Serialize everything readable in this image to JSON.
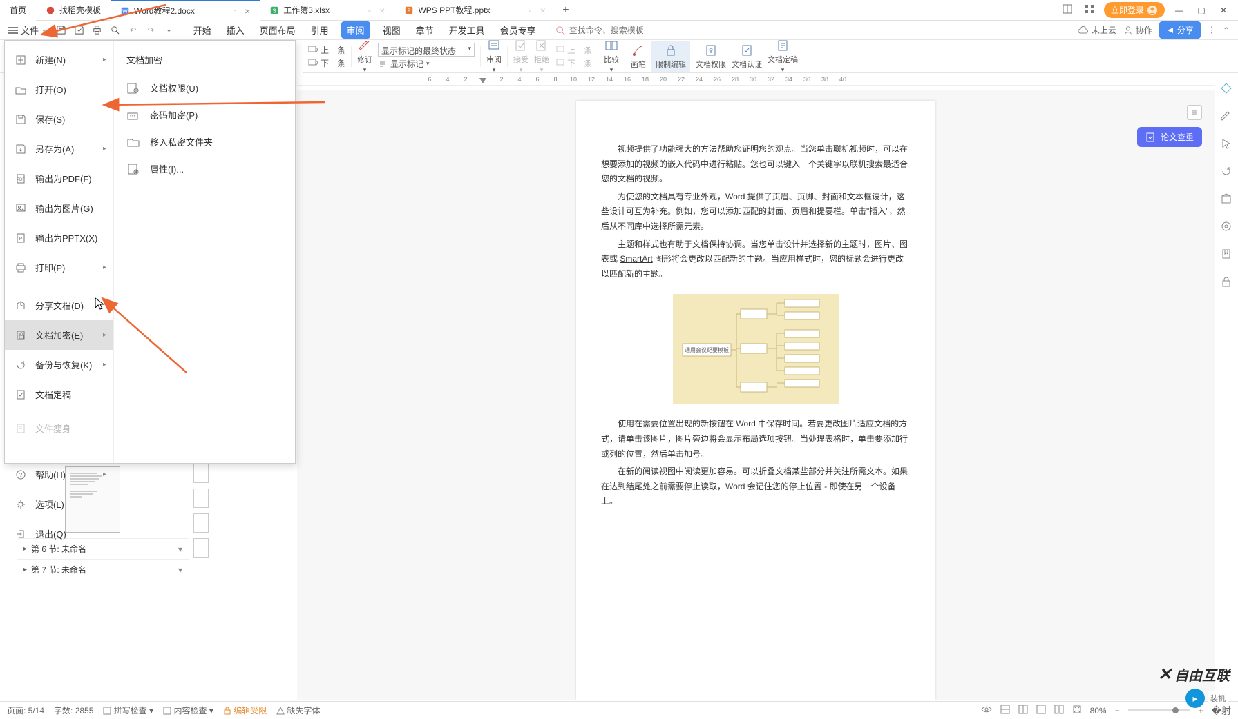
{
  "tabs": {
    "home": "首页",
    "t1": "找稻壳模板",
    "t2": "Word教程2.docx",
    "t3": "工作簿3.xlsx",
    "t4": "WPS PPT教程.pptx"
  },
  "titlebar": {
    "login": "立即登录"
  },
  "menu": {
    "file": "文件",
    "tabs": [
      "开始",
      "插入",
      "页面布局",
      "引用",
      "审阅",
      "视图",
      "章节",
      "开发工具",
      "会员专享"
    ],
    "active_index": 4,
    "search_placeholder": "查找命令、搜索模板",
    "cloud": "未上云",
    "coop": "协作",
    "share": "分享"
  },
  "ribbon": {
    "prev": "上一条",
    "next": "下一条",
    "revise": "修订",
    "show_state_label": "显示标记的最终状态",
    "show_marks": "显示标记",
    "review": "审阅",
    "accept": "接受",
    "reject": "拒绝",
    "go_prev": "上一条",
    "go_next": "下一条",
    "compare": "比较",
    "brush": "画笔",
    "restrict": "限制编辑",
    "doc_perm": "文档权限",
    "doc_auth": "文档认证",
    "doc_final": "文档定稿"
  },
  "file_menu": {
    "items": [
      {
        "label": "新建(N)",
        "arrow": true
      },
      {
        "label": "打开(O)"
      },
      {
        "label": "保存(S)"
      },
      {
        "label": "另存为(A)",
        "arrow": true
      },
      {
        "label": "输出为PDF(F)"
      },
      {
        "label": "输出为图片(G)"
      },
      {
        "label": "输出为PPTX(X)"
      },
      {
        "label": "打印(P)",
        "arrow": true
      },
      {
        "label": "分享文档(D)"
      },
      {
        "label": "文档加密(E)",
        "arrow": true,
        "hover": true
      },
      {
        "label": "备份与恢复(K)",
        "arrow": true
      },
      {
        "label": "文档定稿"
      },
      {
        "label": "文件瘦身",
        "dim": true
      },
      {
        "label": "帮助(H)",
        "arrow": true
      },
      {
        "label": "选项(L)"
      },
      {
        "label": "退出(Q)"
      }
    ],
    "submenu_title": "文档加密",
    "submenu": [
      {
        "label": "文档权限(U)"
      },
      {
        "label": "密码加密(P)"
      },
      {
        "label": "移入私密文件夹"
      },
      {
        "label": "属性(I)..."
      }
    ]
  },
  "ruler": [
    "6",
    "4",
    "2",
    "",
    "2",
    "4",
    "6",
    "8",
    "10",
    "12",
    "14",
    "16",
    "18",
    "20",
    "22",
    "24",
    "26",
    "28",
    "30",
    "32",
    "34",
    "36",
    "38",
    "40"
  ],
  "doc": {
    "p1": "视频提供了功能强大的方法帮助您证明您的观点。当您单击联机视频时，可以在想要添加的视频的嵌入代码中进行粘贴。您也可以键入一个关键字以联机搜索最适合您的文档的视频。",
    "p2a": "为使您的文档具有专业外观，Word 提供了页眉、页脚、封面和文本框设计，这些设计可互为补充。例如，您可以添加匹配的封面、页眉和提要栏。单击\"插入\"，然后从不同库中选择所需元素。",
    "p3a": "主题和样式也有助于文档保持协调。当您单击设计并选择新的主题时，图片、图表或 ",
    "p3link": "SmartArt",
    "p3b": " 图形将会更改以匹配新的主题。当应用样式时，您的标题会进行更改以匹配新的主题。",
    "p4": "使用在需要位置出现的新按钮在 Word 中保存时间。若要更改图片适应文档的方式，请单击该图片，图片旁边将会显示布局选项按钮。当处理表格时，单击要添加行或列的位置，然后单击加号。",
    "p5": "在新的阅读视图中阅读更加容易。可以折叠文档某些部分并关注所需文本。如果在达到结尾处之前需要停止读取，Word 会记住您的停止位置 - 即使在另一个设备上。",
    "diagram_center": "通用会议纪要模板"
  },
  "right": {
    "check": "论文查重"
  },
  "nav": {
    "s6": "第 6 节: 未命名",
    "s7": "第 7 节: 未命名"
  },
  "status": {
    "page": "页面: 5/14",
    "words": "字数: 2855",
    "spell": "拼写检查",
    "content": "内容检查",
    "edit": "编辑受限",
    "font": "缺失字体",
    "zoom": "80%"
  },
  "watermark": {
    "w1": "自由互联",
    "w2": "装机"
  }
}
